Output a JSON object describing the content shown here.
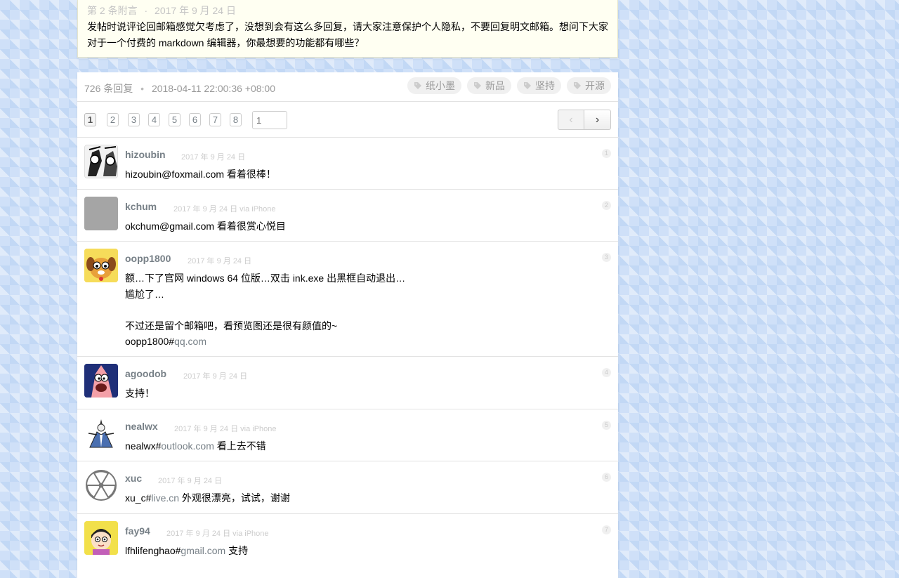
{
  "postscript": {
    "label": "第 2 条附言",
    "sep": "·",
    "date": "2017 年 9 月 24 日",
    "body": "发帖时说评论回邮箱感觉欠考虑了，没想到会有这么多回复，请大家注意保护个人隐私，不要回复明文邮箱。想问下大家对于一个付费的 markdown 编辑器，你最想要的功能都有哪些？"
  },
  "replies_header": {
    "count": "726 条回复",
    "sep": "•",
    "time": "2018-04-11 22:00:36 +08:00",
    "tags": [
      {
        "label": "纸小墨",
        "icon": "tag-icon"
      },
      {
        "label": "新品",
        "icon": "tag-icon"
      },
      {
        "label": "坚持",
        "icon": "tag-icon"
      },
      {
        "label": "开源",
        "icon": "tag-icon"
      }
    ]
  },
  "pager": {
    "pages": [
      "1",
      "2",
      "3",
      "4",
      "5",
      "6",
      "7",
      "8"
    ],
    "current": "1",
    "input_placeholder": "1",
    "prev_icon": "‹",
    "next_icon": "›"
  },
  "replies": [
    {
      "no": "1",
      "author": "hizoubin",
      "time": "2017 年 9 月 24 日",
      "avatar": "manga-avatar",
      "content": "hizoubin@foxmail.com 看着很棒！"
    },
    {
      "no": "2",
      "author": "kchum",
      "time": "2017 年 9 月 24 日 via iPhone",
      "avatar": "gray-avatar",
      "content": "okchum@gmail.com 看着很赏心悦目"
    },
    {
      "no": "3",
      "author": "oopp1800",
      "time": "2017 年 9 月 24 日",
      "avatar": "cartoon-dog-avatar",
      "line1": "额…下了官网 windows 64 位版…双击 ink.exe 出黑框自动退出…",
      "line2": "尴尬了…",
      "line3": "不过还是留个邮箱吧，看预览图还是很有颜值的~",
      "line4_prefix": "oopp1800#",
      "line4_link": "qq.com"
    },
    {
      "no": "4",
      "author": "agoodob",
      "time": "2017 年 9 月 24 日",
      "avatar": "patrick-avatar",
      "content": "支持！"
    },
    {
      "no": "5",
      "author": "nealwx",
      "time": "2017 年 9 月 24 日 via iPhone",
      "avatar": "sketch-avatar",
      "prefix": "nealwx#",
      "link": "outlook.com",
      "suffix": " 看上去不错"
    },
    {
      "no": "6",
      "author": "xuc",
      "time": "2017 年 9 月 24 日",
      "avatar": "radiation-avatar",
      "prefix": "xu_c#",
      "link": "live.cn",
      "suffix": " 外观很漂亮，试试，谢谢"
    },
    {
      "no": "7",
      "author": "fay94",
      "time": "2017 年 9 月 24 日 via iPhone",
      "avatar": "osomatsu-avatar",
      "prefix": "lfhlifenghao#",
      "link": "gmail.com",
      "suffix": " 支持"
    }
  ]
}
